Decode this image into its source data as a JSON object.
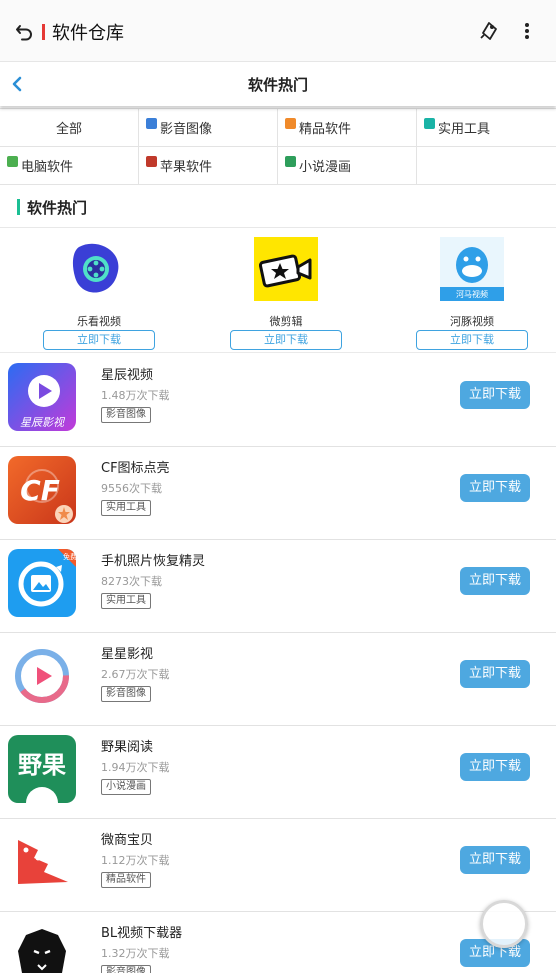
{
  "appbar": {
    "title": "软件仓库",
    "back_icon": "undo-arrow-icon",
    "cast_icon": "cast-icon",
    "more_icon": "more-vertical-icon"
  },
  "subbar": {
    "title": "软件热门",
    "back_icon": "chevron-left-icon"
  },
  "categories": [
    {
      "label": "全部",
      "icon": ""
    },
    {
      "label": "影音图像",
      "icon": "image-icon",
      "color": "#3b7fd8"
    },
    {
      "label": "精品软件",
      "icon": "star-icon",
      "color": "#f08a2a"
    },
    {
      "label": "实用工具",
      "icon": "tool-icon",
      "color": "#1ab3a6"
    },
    {
      "label": "电脑软件",
      "icon": "pc-icon",
      "color": "#4caf50"
    },
    {
      "label": "苹果软件",
      "icon": "apple-icon",
      "color": "#c0392b"
    },
    {
      "label": "小说漫画",
      "icon": "book-icon",
      "color": "#2e9e5b"
    }
  ],
  "section": {
    "title": "软件热门"
  },
  "featured": [
    {
      "name": "乐看视频",
      "button": "立即下载"
    },
    {
      "name": "微剪辑",
      "button": "立即下载"
    },
    {
      "name": "河豚视频",
      "button": "立即下载",
      "icon_text": "河马视频"
    }
  ],
  "list": [
    {
      "name": "星辰视频",
      "count": "1.48万次下载",
      "tag": "影音图像",
      "button": "立即下载",
      "icon_text": "星辰影视"
    },
    {
      "name": "CF图标点亮",
      "count": "9556次下载",
      "tag": "实用工具",
      "button": "立即下载",
      "icon_text": "CF"
    },
    {
      "name": "手机照片恢复精灵",
      "count": "8273次下载",
      "tag": "实用工具",
      "button": "立即下载",
      "icon_text": "免费"
    },
    {
      "name": "星星影视",
      "count": "2.67万次下载",
      "tag": "影音图像",
      "button": "立即下载"
    },
    {
      "name": "野果阅读",
      "count": "1.94万次下载",
      "tag": "小说漫画",
      "button": "立即下载",
      "icon_text": "野果"
    },
    {
      "name": "微商宝贝",
      "count": "1.12万次下载",
      "tag": "精品软件",
      "button": "立即下载"
    },
    {
      "name": "BL视频下载器",
      "count": "1.32万次下载",
      "tag": "影音图像",
      "button": "立即下载"
    }
  ]
}
